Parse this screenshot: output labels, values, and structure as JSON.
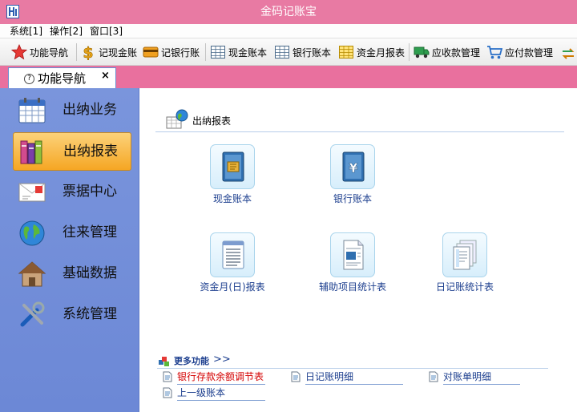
{
  "window": {
    "title": "金码记账宝"
  },
  "menu": [
    "系统[1]",
    "操作[2]",
    "窗口[3]"
  ],
  "toolbar": {
    "items": [
      {
        "label": "功能导航",
        "icon": "star-icon"
      },
      {
        "label": "记现金账",
        "icon": "dollar-icon"
      },
      {
        "label": "记银行账",
        "icon": "bank-card-icon"
      },
      {
        "label": "现金账本",
        "icon": "ledger-grid-icon"
      },
      {
        "label": "银行账本",
        "icon": "ledger-grid-icon"
      },
      {
        "label": "资金月报表",
        "icon": "monthly-report-icon"
      },
      {
        "label": "应收款管理",
        "icon": "truck-icon"
      },
      {
        "label": "应付款管理",
        "icon": "cart-icon"
      }
    ]
  },
  "tab": {
    "label": "功能导航",
    "help_glyph": "?",
    "close_glyph": "×"
  },
  "sidebar": {
    "items": [
      {
        "label": "出纳业务",
        "icon": "calendar-icon",
        "active": false
      },
      {
        "label": "出纳报表",
        "icon": "books-icon",
        "active": true
      },
      {
        "label": "票据中心",
        "icon": "envelope-stamp-icon",
        "active": false
      },
      {
        "label": "往来管理",
        "icon": "globe-icon",
        "active": false
      },
      {
        "label": "基础数据",
        "icon": "house-icon",
        "active": false
      },
      {
        "label": "系统管理",
        "icon": "tools-icon",
        "active": false
      }
    ]
  },
  "main": {
    "section_title": "出纳报表",
    "reports": [
      {
        "label": "现金账本",
        "icon": "cash-ledger-icon"
      },
      {
        "label": "银行账本",
        "icon": "bank-ledger-icon"
      },
      {
        "label": "资金月(日)报表",
        "icon": "notepad-icon"
      },
      {
        "label": "辅助项目统计表",
        "icon": "document-chart-icon"
      },
      {
        "label": "日记账统计表",
        "icon": "document-stack-icon"
      }
    ],
    "more": {
      "label": "更多功能",
      "arrows": ">>"
    },
    "quick_links": [
      {
        "label": "银行存款余额调节表",
        "color": "#d40000"
      },
      {
        "label": "日记账明细",
        "color": "#1d3f8f"
      },
      {
        "label": "对账单明细",
        "color": "#1d3f8f"
      },
      {
        "label": "上一级账本",
        "color": "#1d3f8f"
      }
    ]
  },
  "colors": {
    "title_bar": "#e87aa3",
    "sidebar": "#7a95dc",
    "active_item": "#f5a623",
    "link_blue": "#1d3f8f",
    "link_red": "#d40000"
  }
}
